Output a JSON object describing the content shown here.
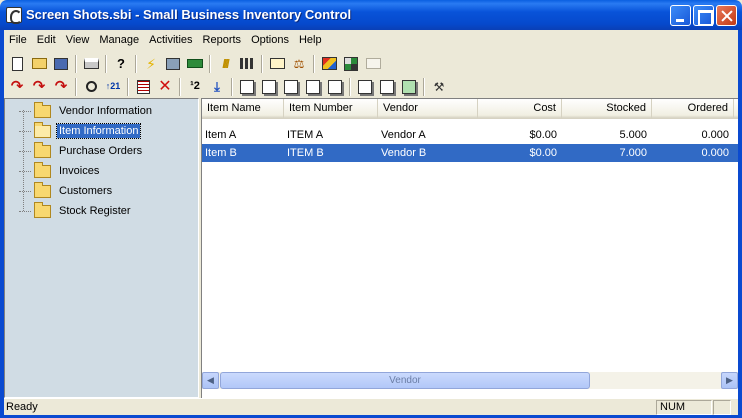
{
  "window": {
    "title": "Screen Shots.sbi - Small Business Inventory Control"
  },
  "menu": [
    "File",
    "Edit",
    "View",
    "Manage",
    "Activities",
    "Reports",
    "Options",
    "Help"
  ],
  "toolbar1": [
    "new-doc-icon",
    "open-folder-icon",
    "save-disk-icon",
    "print-icon",
    "help-question-icon",
    "lightning-icon",
    "truck-icon",
    "money-icon",
    "dashes-icon",
    "grid-icon",
    "envelope-icon",
    "scale-icon",
    "color-chart-icon",
    "mosaic-icon",
    "blank-card-icon"
  ],
  "toolbar2": [
    "red-arrow-icon",
    "red-arrow-add-icon",
    "red-arrow-edit-icon",
    "magnifier-icon",
    "sort-icon",
    "form-icon",
    "delete-x-icon",
    "numbering-icon",
    "download-icon",
    "page1-icon",
    "page2-icon",
    "page3-icon",
    "page4-icon",
    "page5-icon",
    "page6-icon",
    "page7-icon",
    "page8-icon",
    "tools-icon"
  ],
  "tree": {
    "items": [
      {
        "label": "Vendor Information",
        "selected": false
      },
      {
        "label": "Item Information",
        "selected": true
      },
      {
        "label": "Purchase Orders",
        "selected": false
      },
      {
        "label": "Invoices",
        "selected": false
      },
      {
        "label": "Customers",
        "selected": false
      },
      {
        "label": "Stock Register",
        "selected": false
      }
    ]
  },
  "list": {
    "columns": [
      "Item Name",
      "Item Number",
      "Vendor",
      "Cost",
      "Stocked",
      "Ordered"
    ],
    "rows": [
      {
        "name": "Item A",
        "number": "ITEM A",
        "vendor": "Vendor A",
        "cost": "$0.00",
        "stocked": "5.000",
        "ordered": "0.000",
        "selected": false
      },
      {
        "name": "Item B",
        "number": "ITEM B",
        "vendor": "Vendor B",
        "cost": "$0.00",
        "stocked": "7.000",
        "ordered": "0.000",
        "selected": true
      }
    ],
    "scrollbar_label": "Vendor"
  },
  "status": {
    "text": "Ready",
    "num": "NUM"
  },
  "colors": {
    "selection": "#316AC5",
    "title_bar": "#0853D9",
    "tree_bg": "#D0DCE4"
  }
}
